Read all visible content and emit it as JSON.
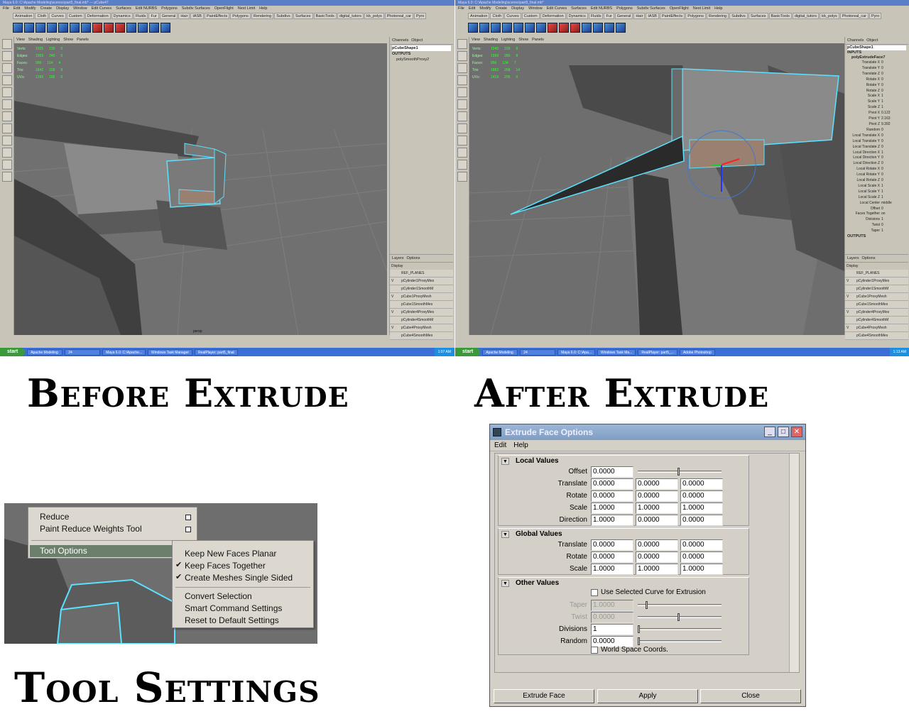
{
  "shared_menubar": [
    "File",
    "Edit",
    "Modify",
    "Create",
    "Display",
    "Window",
    "Edit Curves",
    "Surfaces",
    "Edit NURBS",
    "Polygons",
    "Subdiv Surfaces",
    "OpenFlight",
    "Next Limit",
    "Help"
  ],
  "shared_shelftabs": [
    "Animation",
    "Cloth",
    "Curves",
    "Custom",
    "Deformation",
    "Dynamics",
    "Fluids",
    "Fur",
    "General",
    "Hair",
    "IASB",
    "PaintEffects",
    "Polygons",
    "Rendering",
    "Subdivs",
    "Surfaces",
    "BasicTools",
    "digital_tutors",
    "kb_polys",
    "Photoreal_car",
    "Pyro"
  ],
  "vp_menu": [
    "View",
    "Shading",
    "Lighting",
    "Show",
    "Panels"
  ],
  "before": {
    "title": "Maya 6.0: C:\\Apache Modeling\\scenes\\part5_final.mb* --- pCube47",
    "hud": [
      [
        "Verts:",
        "1025",
        "135",
        "0"
      ],
      [
        "Edges:",
        "1959",
        "240",
        "0"
      ],
      [
        "Faces:",
        "936",
        "114",
        "4"
      ],
      [
        "Tris:",
        "1842",
        "228",
        "8"
      ],
      [
        "UVs:",
        "1399",
        "185",
        "0"
      ]
    ],
    "panel_tabs": [
      "Channels",
      "Object"
    ],
    "channels": [
      "pCubeShape1",
      "OUTPUTS",
      "polySmoothProxy2"
    ],
    "camera": "persp",
    "layers_menu": [
      "Layers",
      "Options"
    ],
    "layers_display": "Display",
    "layers": [
      [
        "",
        "REF_PLANES"
      ],
      [
        "V",
        "pCylinder1ProxyMes"
      ],
      [
        "",
        "pCylinder1SmoothM"
      ],
      [
        "V",
        "pCube1ProxyMesh"
      ],
      [
        "",
        "pCube1SmoothMes"
      ],
      [
        "V",
        "pCylinder4ProxyMes"
      ],
      [
        "",
        "pCylinder4SmoothM"
      ],
      [
        "V",
        "pCube4ProxyMesh"
      ],
      [
        "",
        "pCube4SmoothMes"
      ]
    ],
    "start": "start",
    "taskbar": [
      "Apache Modeling",
      "24",
      "Maya 6.0: C:\\Apache...",
      "Windows Task Manager",
      "RealPlayer: part5_final"
    ],
    "clock": "1:07 AM"
  },
  "after": {
    "title": "Maya 6.0: C:\\Apache Modeling\\scenes\\part5_final.mb*",
    "hud": [
      [
        "Verts:",
        "1045",
        "155",
        "8"
      ],
      [
        "Edges:",
        "1999",
        "280",
        "8"
      ],
      [
        "Faces:",
        "956",
        "134",
        "7"
      ],
      [
        "Tris:",
        "1882",
        "268",
        "14"
      ],
      [
        "UVs:",
        "1419",
        "205",
        "0"
      ]
    ],
    "panel_tabs": [
      "Channels",
      "Object"
    ],
    "channels": [
      "pCubeShape1",
      "INPUTS",
      "polyExtrudeFace7"
    ],
    "attrs": [
      [
        "Translate X",
        "0"
      ],
      [
        "Translate Y",
        "0"
      ],
      [
        "Translate Z",
        "0"
      ],
      [
        "Rotate X",
        "0"
      ],
      [
        "Rotate Y",
        "0"
      ],
      [
        "Rotate Z",
        "0"
      ],
      [
        "Scale X",
        "1"
      ],
      [
        "Scale Y",
        "1"
      ],
      [
        "Scale Z",
        "1"
      ],
      [
        "Pivot X",
        "0.122"
      ],
      [
        "Pivot Y",
        "2.163"
      ],
      [
        "Pivot Z",
        "9.392"
      ],
      [
        "Random",
        "0"
      ],
      [
        "Local Translate X",
        "0"
      ],
      [
        "Local Translate Y",
        "0"
      ],
      [
        "Local Translate Z",
        "0"
      ],
      [
        "Local Direction X",
        "1"
      ],
      [
        "Local Direction Y",
        "0"
      ],
      [
        "Local Direction Z",
        "0"
      ],
      [
        "Local Rotate X",
        "0"
      ],
      [
        "Local Rotate Y",
        "0"
      ],
      [
        "Local Rotate Z",
        "0"
      ],
      [
        "Local Scale X",
        "1"
      ],
      [
        "Local Scale Y",
        "1"
      ],
      [
        "Local Scale Z",
        "1"
      ],
      [
        "Local Center",
        "middle"
      ],
      [
        "Offset",
        "0"
      ],
      [
        "Faces Together",
        "on"
      ],
      [
        "Divisions",
        "1"
      ],
      [
        "Twist",
        "0"
      ],
      [
        "Taper",
        "1"
      ]
    ],
    "outputs": "OUTPUTS",
    "layers_menu": [
      "Layers",
      "Options"
    ],
    "layers_display": "Display",
    "layers": [
      [
        "",
        "REF_PLANES"
      ],
      [
        "V",
        "pCylinder1ProxyMes"
      ],
      [
        "",
        "pCylinder1SmoothM"
      ],
      [
        "V",
        "pCube1ProxyMesh"
      ],
      [
        "",
        "pCube1SmoothMes"
      ],
      [
        "V",
        "pCylinder4ProxyMes"
      ],
      [
        "",
        "pCylinder4SmoothM"
      ],
      [
        "V",
        "pCube4ProxyMesh"
      ],
      [
        "",
        "pCube4SmoothMes"
      ]
    ],
    "start": "start",
    "taskbar": [
      "Apache Modeling",
      "24",
      "Maya 6.0: C:\\Apa...",
      "Windows Task Ma...",
      "RealPlayer: part5_...",
      "Adobe Photoshop"
    ],
    "clock": "1:13 AM"
  },
  "headings": {
    "before": "Before Extrude",
    "after": "After Extrude",
    "tool": "Tool Settings"
  },
  "menu": {
    "reduce": "Reduce",
    "paint_reduce": "Paint Reduce Weights Tool",
    "tool_options": "Tool Options",
    "sub": {
      "keep_planar": "Keep New Faces Planar",
      "keep_together": "Keep Faces Together",
      "single_sided": "Create Meshes Single Sided",
      "convert": "Convert Selection",
      "smart": "Smart Command Settings",
      "reset": "Reset to Default Settings"
    }
  },
  "dialog": {
    "title": "Extrude Face Options",
    "menu": [
      "Edit",
      "Help"
    ],
    "local": {
      "header": "Local Values",
      "offset_label": "Offset",
      "offset": "0.0000",
      "translate_label": "Translate",
      "translate": [
        "0.0000",
        "0.0000",
        "0.0000"
      ],
      "rotate_label": "Rotate",
      "rotate": [
        "0.0000",
        "0.0000",
        "0.0000"
      ],
      "scale_label": "Scale",
      "scale": [
        "1.0000",
        "1.0000",
        "1.0000"
      ],
      "direction_label": "Direction",
      "direction": [
        "1.0000",
        "0.0000",
        "0.0000"
      ]
    },
    "global": {
      "header": "Global Values",
      "translate_label": "Translate",
      "translate": [
        "0.0000",
        "0.0000",
        "0.0000"
      ],
      "rotate_label": "Rotate",
      "rotate": [
        "0.0000",
        "0.0000",
        "0.0000"
      ],
      "scale_label": "Scale",
      "scale": [
        "1.0000",
        "1.0000",
        "1.0000"
      ]
    },
    "other": {
      "header": "Other Values",
      "use_curve": "Use Selected Curve for Extrusion",
      "taper_label": "Taper",
      "taper": "1.0000",
      "twist_label": "Twist",
      "twist": "0.0000",
      "divisions_label": "Divisions",
      "divisions": "1",
      "random_label": "Random",
      "random": "0.0000",
      "world_space": "World Space Coords."
    },
    "buttons": {
      "extrude": "Extrude Face",
      "apply": "Apply",
      "close": "Close"
    },
    "sliders": {
      "offset": 0.5,
      "taper": 0.1,
      "twist": 0.5,
      "divisions": 0.0,
      "random": 0.0
    }
  }
}
